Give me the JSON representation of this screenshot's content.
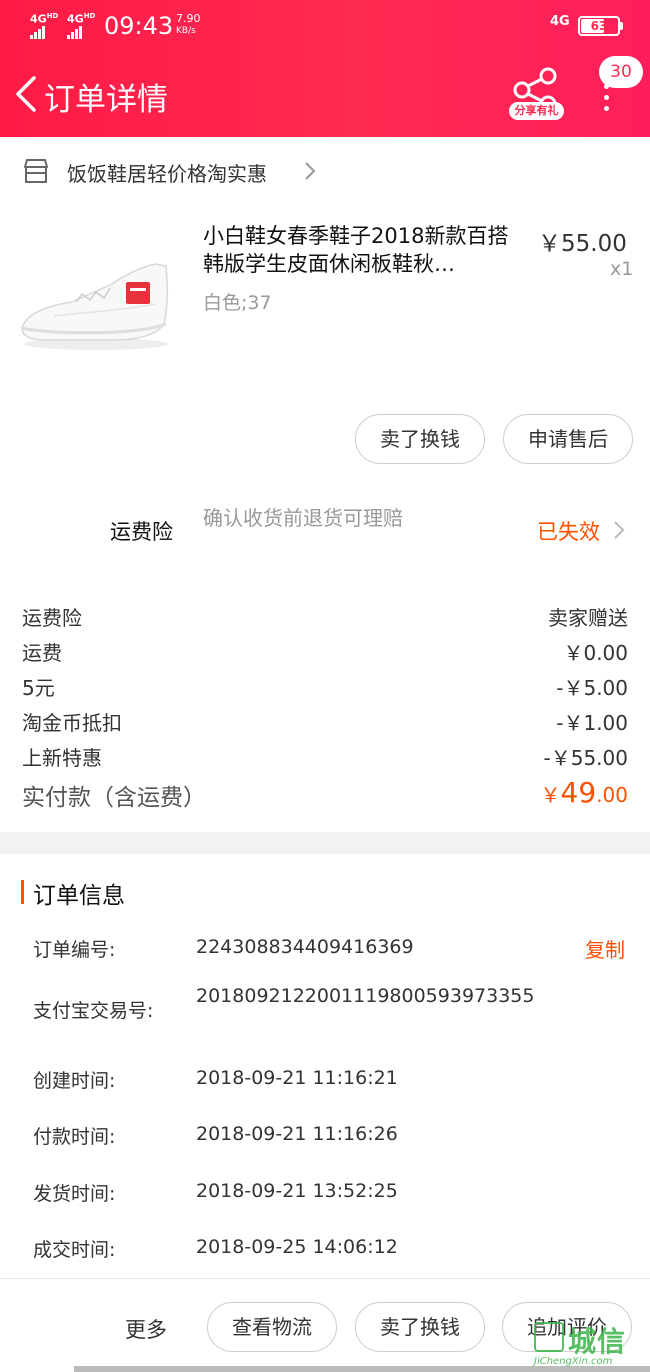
{
  "status_bar": {
    "sim1": "4G",
    "sim1_sup": "HD",
    "sim2": "4G",
    "sim2_sup": "HD",
    "time": "09:43",
    "speed_value": "7.90",
    "speed_unit": "KB/s",
    "network": "4G",
    "battery": "63",
    "battery_level": 0.63
  },
  "header": {
    "title": "订单详情",
    "share_label": "分享有礼",
    "message_count": "30"
  },
  "store": {
    "name": "饭饭鞋居轻价格淘实惠"
  },
  "product": {
    "title": "小白鞋女春季鞋子2018新款百搭韩版学生皮面休闲板鞋秋…",
    "price": "￥55.00",
    "quantity": "x1",
    "sku": "白色;37"
  },
  "product_actions": {
    "resell": "卖了换钱",
    "after_sale": "申请售后"
  },
  "insurance": {
    "label": "运费险",
    "description": "确认收货前退货可理赔",
    "status": "已失效"
  },
  "fees": [
    {
      "label": "运费险",
      "value": "卖家赠送"
    },
    {
      "label": "运费",
      "value": "￥0.00"
    },
    {
      "label": "5元",
      "value": "-￥5.00"
    },
    {
      "label": "淘金币抵扣",
      "value": "-￥1.00"
    },
    {
      "label": "上新特惠",
      "value": "-￥55.00"
    }
  ],
  "total": {
    "label": "实付款（含运费）",
    "currency": "￥",
    "integer": "49",
    "decimal": ".00"
  },
  "order_info": {
    "title": "订单信息",
    "copy_label": "复制",
    "rows": [
      {
        "label": "订单编号:",
        "value": "224308834409416369"
      },
      {
        "label": "支付宝交易号:",
        "value": "2018092122001119800593973355"
      },
      {
        "label": "创建时间:",
        "value": "2018-09-21 11:16:21"
      },
      {
        "label": "付款时间:",
        "value": "2018-09-21 11:16:26"
      },
      {
        "label": "发货时间:",
        "value": "2018-09-21 13:52:25"
      },
      {
        "label": "成交时间:",
        "value": "2018-09-25 14:06:12"
      }
    ]
  },
  "bottom_bar": {
    "more": "更多",
    "logistics": "查看物流",
    "resell": "卖了换钱",
    "review": "追加评价"
  },
  "watermark": {
    "text": "城信",
    "url": "JiChengXin.com"
  },
  "colors": {
    "header_red": "#ff2a52",
    "accent_orange": "#ff5000"
  }
}
